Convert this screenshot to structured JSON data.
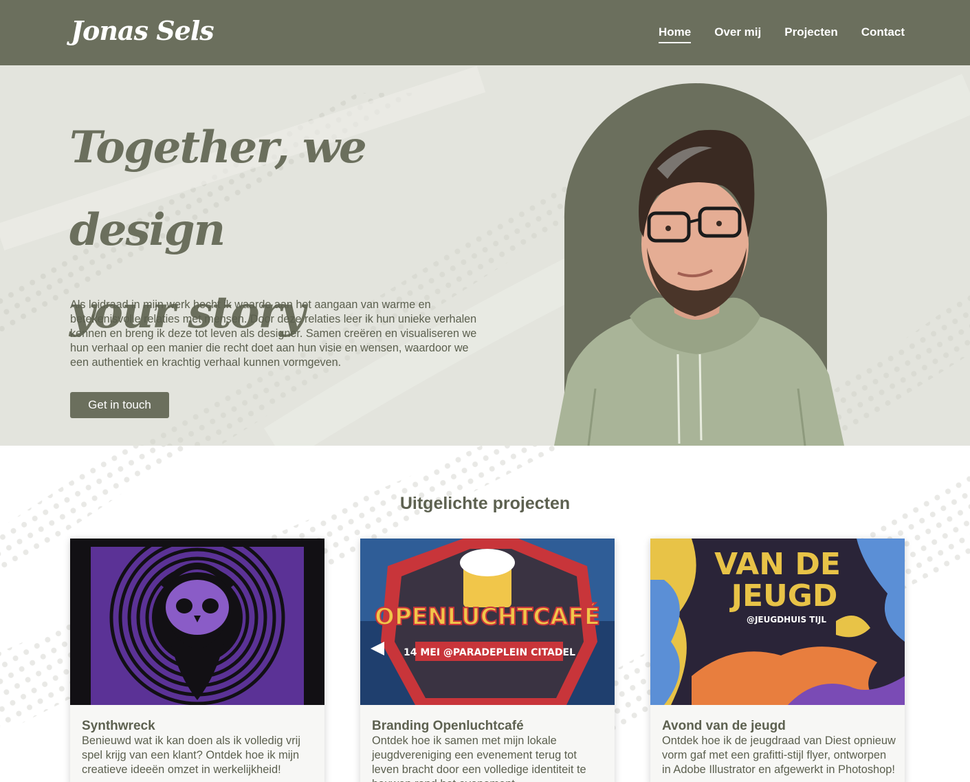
{
  "brand": {
    "logo": "Jonas Sels"
  },
  "nav": {
    "items": [
      {
        "label": "Home",
        "active": true
      },
      {
        "label": "Over mij",
        "active": false
      },
      {
        "label": "Projecten",
        "active": false
      },
      {
        "label": "Contact",
        "active": false
      }
    ]
  },
  "hero": {
    "title_line1": "Together, we design",
    "title_line2": "your story",
    "text": "Als leidraad in mijn werk hecht ik waarde aan het aangaan van warme en betekenisvolle relaties met mensen. Door deze relaties leer ik hun unieke verhalen kennen en breng ik deze tot leven als designer. Samen creëren en visualiseren we hun verhaal op een manier die recht doet aan hun visie en wensen, waardoor we een authentiek en krachtig verhaal kunnen vormgeven.",
    "cta_label": "Get in touch"
  },
  "projects": {
    "heading": "Uitgelichte projecten",
    "cards": [
      {
        "title": "Synthwreck",
        "description": "Benieuwd wat ik kan doen als ik volledig vrij spel krijg van een klant? Ontdek hoe ik mijn creatieve ideeën omzet in werkelijkheid!"
      },
      {
        "title": "Branding Openluchtcafé",
        "description": "Ontdek hoe ik samen met mijn lokale jeugdvereniging een evenement terug tot leven bracht door een volledige identiteit te bouwen rond het evenement.",
        "poster_title": "OPENLUCHTCAFÉ",
        "poster_banner": "14 MEI @PARADEPLEIN CITADEL"
      },
      {
        "title": "Avond van de jeugd",
        "description": "Ontdek hoe ik de jeugdraad van Diest opnieuw vorm gaf met een grafitti-stijl flyer, ontworpen in Adobe Illustrator en afgewerkt in Photoshop!",
        "poster_line1": "VAN DE",
        "poster_line2": "JEUGD",
        "poster_handle": "@JEUGDHUIS TIJL"
      }
    ]
  },
  "colors": {
    "olive": "#6b6f5d",
    "hero_bg": "#e3e4dd",
    "purple": "#6a3aa0",
    "poster_red": "#c8353a",
    "poster_yellow": "#e8c347",
    "poster_orange": "#e87e3e"
  }
}
